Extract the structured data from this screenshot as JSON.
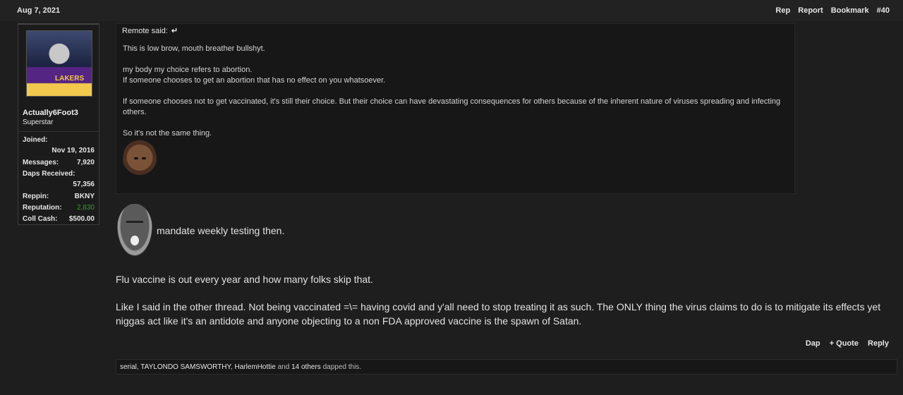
{
  "post": {
    "date": "Aug 7, 2021",
    "actions": {
      "rep": "Rep",
      "report": "Report",
      "bookmark": "Bookmark",
      "number": "#40"
    }
  },
  "user": {
    "avatar_icon": "user-avatar",
    "name": "Actually6Foot3",
    "title": "Superstar",
    "stats": {
      "joined_label": "Joined:",
      "joined_value": "Nov 19, 2016",
      "messages_label": "Messages:",
      "messages_value": "7,920",
      "daps_label": "Daps Received:",
      "daps_value": "57,356",
      "reppin_label": "Reppin:",
      "reppin_value": "BKNY",
      "reputation_label": "Reputation:",
      "reputation_value": "2,830",
      "collcash_label": "Coll Cash:",
      "collcash_value": "$500.00"
    },
    "reputation_color": "#3a9a3a"
  },
  "quote": {
    "author": "Remote said:",
    "arrow": "↵",
    "paragraphs": [
      "This is low brow, mouth breather bullshyt.",
      "my body my choice refers to abortion.",
      "If someone chooses to get an abortion that has no effect on you whatsoever.",
      "If someone chooses not to get vaccinated, it's still their choice. But their choice can have devastating consequences for others because of the inherent nature of viruses spreading and infecting others.",
      "So it's not the same thing."
    ]
  },
  "body": {
    "line1": "mandate weekly testing then.",
    "line2": "Flu vaccine is out every year and how many folks skip that.",
    "line3": "Like I said in the other thread. Not being vaccinated =\\= having covid and y'all need to stop treating it as such. The ONLY thing the virus claims to do is to mitigate its effects yet niggas act like it's an antidote and anyone objecting to a non FDA approved vaccine is the spawn of Satan."
  },
  "footer": {
    "dap": "Dap",
    "quote": "+ Quote",
    "reply": "Reply"
  },
  "daps": {
    "users": [
      "serial",
      "TAYLONDO SAMSWORTHY",
      "HarlemHottie"
    ],
    "and": "and",
    "others": "14 others",
    "suffix": "dapped this."
  }
}
